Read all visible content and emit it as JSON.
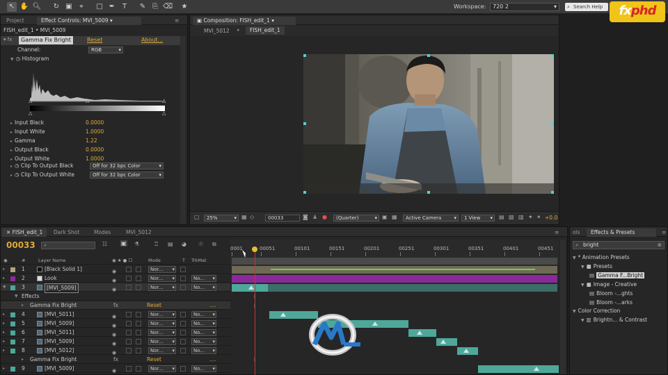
{
  "toolbar": {
    "workspace_label": "Workspace:",
    "workspace_value": "720 2",
    "search_help": "Search Help"
  },
  "brand": {
    "logo_text_a": "fx",
    "logo_text_b": "phd"
  },
  "left_panel": {
    "tab_project": "Project",
    "tab_effect_controls": "Effect Controls: MVI_5009",
    "breadcrumb": "FISH_edit_1 • MVI_5009",
    "effect_name": "Gamma Fix Bright",
    "reset": "Reset",
    "about": "About...",
    "channel_label": "Channel:",
    "channel_value": "RGB",
    "histogram_label": "Histogram",
    "params": [
      {
        "label": "Input Black",
        "value": "0.0000"
      },
      {
        "label": "Input White",
        "value": "1.0000"
      },
      {
        "label": "Gamma",
        "value": "1.22"
      },
      {
        "label": "Output Black",
        "value": "0.0000"
      },
      {
        "label": "Output White",
        "value": "1.0000"
      }
    ],
    "clip_black_label": "Clip To Output Black",
    "clip_black_value": "Off for 32 bpc Color",
    "clip_white_label": "Clip To Output White",
    "clip_white_value": "Off for 32 bpc Color"
  },
  "composition": {
    "tab": "Composition: FISH_edit_1",
    "crumb1": "MVI_5012",
    "crumb2": "FISH_edit_1",
    "zoom": "25%",
    "timecode": "00033",
    "resolution": "(Quarter)",
    "camera": "Active Camera",
    "views": "1 View",
    "exposure": "+0.0"
  },
  "timeline": {
    "tabs": [
      "FISH_edit_1",
      "Dark Shot",
      "Modes",
      "MVI_5012"
    ],
    "current_time": "00033",
    "col_num": "#",
    "col_layer_name": "Layer Name",
    "col_mode": "Mode",
    "col_t": "T",
    "col_trkmat": "TrkMat",
    "ticks": [
      "0001",
      "00051",
      "00101",
      "00151",
      "00201",
      "00251",
      "00301",
      "00351",
      "00401",
      "00451"
    ],
    "ruler_label_b": "00051",
    "layers": [
      {
        "num": "1",
        "name": "[Black Solid 1]",
        "mode": "Nor...",
        "trk": ""
      },
      {
        "num": "2",
        "name": "Look",
        "mode": "Nor...",
        "trk": "No..."
      },
      {
        "num": "3",
        "name": "[MVI_5009]",
        "mode": "Nor...",
        "trk": "No..."
      },
      {
        "num": "4",
        "name": "[MVI_5011]",
        "mode": "Nor...",
        "trk": "No..."
      },
      {
        "num": "5",
        "name": "[MVI_5009]",
        "mode": "Nor...",
        "trk": "No..."
      },
      {
        "num": "6",
        "name": "[MVI_5011]",
        "mode": "Nor...",
        "trk": "No..."
      },
      {
        "num": "7",
        "name": "[MVI_5009]",
        "mode": "Nor...",
        "trk": "No..."
      },
      {
        "num": "8",
        "name": "[MVI_5012]",
        "mode": "Nor...",
        "trk": "No..."
      },
      {
        "num": "9",
        "name": "[MVI_5009]",
        "mode": "Nor...",
        "trk": "No..."
      }
    ],
    "effects_label": "Effects",
    "effect_row_name": "Gamma Fix Bright",
    "effect_reset": "Reset",
    "effect_dots": "....",
    "fx_glyph": "fx"
  },
  "effects_presets": {
    "tab_tools": "ols",
    "tab": "Effects & Presets",
    "search_value": "bright",
    "tree": [
      {
        "label": "* Animation Presets",
        "indent": 0
      },
      {
        "label": "Presets",
        "indent": 1
      },
      {
        "label": "Gamma F...Bright",
        "indent": 2
      },
      {
        "label": "Image - Creative",
        "indent": 1
      },
      {
        "label": "Bloom -...ghts",
        "indent": 2
      },
      {
        "label": "Bloom -...arks",
        "indent": 2
      },
      {
        "label": "Color Correction",
        "indent": 0
      },
      {
        "label": "Brightn... & Contrast",
        "indent": 1
      }
    ]
  },
  "colors": {
    "accent": "#e0a93a",
    "layer_teal": "#4ea89a",
    "purple": "#8a2a9a"
  }
}
